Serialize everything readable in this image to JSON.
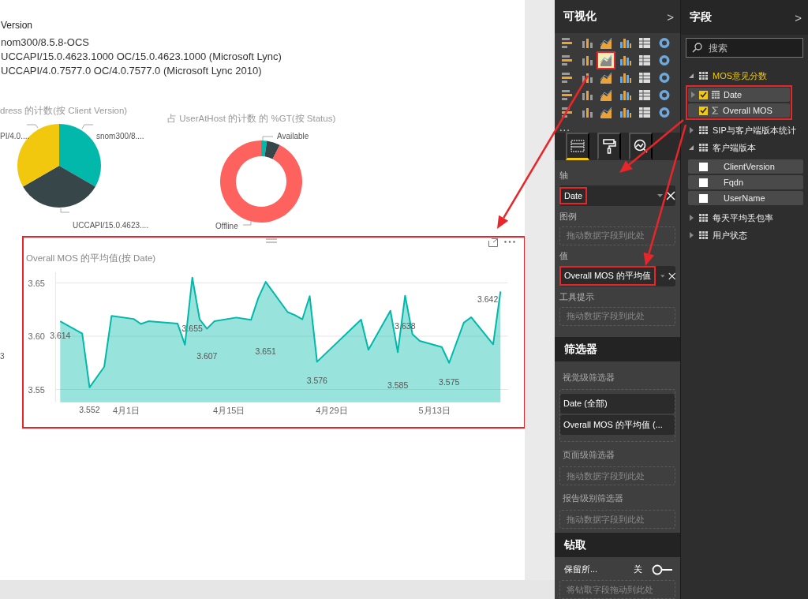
{
  "table_visual": {
    "header": "Version",
    "rows": [
      "nom300/8.5.8-OCS",
      "UCCAPI/15.0.4623.1000 OC/15.0.4623.1000 (Microsoft Lync)",
      "UCCAPI/4.0.7577.0 OC/4.0.7577.0 (Microsoft Lync 2010)"
    ]
  },
  "pie_visual": {
    "title": "dress 的计数(按 Client Version)",
    "labels": [
      "PI/4.0....",
      "snom300/8....",
      "UCCAPI/15.0.4623...."
    ]
  },
  "donut_visual": {
    "title": "占 UserAtHost 的计数 的 %GT(按 Status)",
    "labels": [
      "Available",
      "Offline"
    ]
  },
  "partial_visual_label": "3",
  "line_visual": {
    "highlighted": true,
    "chart_data": {
      "type": "area",
      "title": "Overall MOS 的平均值(按 Date)",
      "categories": [
        null,
        null,
        null,
        null,
        null,
        null,
        null,
        null,
        null,
        "4月1日",
        null,
        null,
        null,
        null,
        null,
        null,
        null,
        null,
        null,
        null,
        null,
        null,
        null,
        "4月15日",
        null,
        null,
        null,
        null,
        null,
        null,
        null,
        null,
        null,
        null,
        null,
        null,
        null,
        "4月29日",
        null,
        null,
        null,
        null,
        null,
        null,
        null,
        null,
        null,
        null,
        null,
        null,
        null,
        "5月13日",
        null,
        null,
        null,
        null,
        null,
        null,
        null,
        null,
        null
      ],
      "series": [
        {
          "color": "#01b8aa",
          "values": [
            3.614,
            null,
            null,
            3.6025,
            3.552,
            null,
            3.5713,
            3.6191,
            null,
            null,
            3.6162,
            3.6115,
            3.614,
            null,
            null,
            null,
            3.6118,
            3.592,
            3.655,
            3.6159,
            3.607,
            3.614,
            null,
            null,
            3.6175,
            null,
            3.6153,
            3.636,
            3.651,
            null,
            null,
            3.6226,
            3.6197,
            3.6159,
            3.6376,
            3.576,
            null,
            null,
            null,
            null,
            null,
            3.6156,
            3.5873,
            null,
            null,
            3.6239,
            3.585,
            3.638,
            3.6019,
            3.5955,
            null,
            null,
            3.5898,
            3.575,
            null,
            3.6127,
            3.6178,
            null,
            null,
            3.5924,
            3.642
          ]
        }
      ],
      "grid": true,
      "ylim": [
        3.538,
        3.66
      ],
      "yticks": [
        3.55,
        {
          "value": 3.6,
          "label": "3.60"
        },
        3.65
      ],
      "annotations": [
        "3.614",
        "3.552",
        "3.655",
        "3.607",
        "3.651",
        "3.576",
        "3.638",
        "3.585",
        "3.575",
        "3.642"
      ]
    }
  },
  "visualizations_pane": {
    "title": "可视化",
    "collapse": ">",
    "gallery": [
      {
        "selected": false
      },
      {
        "selected": false
      },
      {
        "selected": false
      },
      {
        "selected": false
      },
      {
        "selected": false
      },
      {
        "selected": false
      },
      {
        "selected": false
      },
      {
        "selected": false
      },
      {
        "selected": true
      },
      {
        "selected": false
      },
      {
        "selected": false
      },
      {
        "selected": false
      },
      {
        "selected": false
      },
      {
        "selected": false
      },
      {
        "selected": false
      },
      {
        "selected": false
      },
      {
        "selected": false
      },
      {
        "selected": false
      },
      {
        "selected": false
      },
      {
        "selected": false
      },
      {
        "selected": false
      },
      {
        "selected": false
      },
      {
        "selected": false
      },
      {
        "selected": false
      },
      {
        "selected": false
      },
      {
        "selected": false
      },
      {
        "selected": false
      },
      {
        "selected": false
      },
      {
        "selected": false
      },
      {
        "selected": false
      }
    ],
    "more": "...",
    "tabs": [
      {
        "selected": true
      },
      {
        "selected": false
      },
      {
        "selected": false
      }
    ],
    "wells": [
      {
        "label": "轴",
        "kind": "field",
        "value": "Date",
        "highlighted": true
      },
      {
        "label": "图例",
        "kind": "empty",
        "placeholder": "拖动数据字段到此处"
      },
      {
        "label": "值",
        "kind": "field",
        "value": "Overall MOS 的平均值",
        "highlighted": true
      },
      {
        "label": "工具提示",
        "kind": "empty",
        "placeholder": "拖动数据字段到此处"
      }
    ]
  },
  "filters": {
    "title": "筛选器",
    "sections": [
      {
        "label": "视觉级筛选器",
        "cards": [
          "Date (全部)",
          "Overall MOS 的平均值 (..."
        ]
      },
      {
        "label": "页面级筛选器",
        "placeholder": "拖动数据字段到此处"
      },
      {
        "label": "报告级别筛选器",
        "placeholder": "拖动数据字段到此处"
      }
    ]
  },
  "drillthrough": {
    "title": "钻取",
    "keep_label": "保留所...",
    "toggle_text": "关",
    "on": false,
    "placeholder": "将钻取字段拖动到此处"
  },
  "fields_pane": {
    "title": "字段",
    "collapse": ">",
    "search": {
      "placeholder": "搜索"
    },
    "tables": [
      {
        "name": "MOS意见分数",
        "expanded": true,
        "in_use": true,
        "fields_highlighted": true,
        "fields": [
          {
            "name": "Date",
            "kind": "date",
            "checked": true,
            "expandable": true
          },
          {
            "name": "Overall MOS",
            "kind": "measure",
            "checked": true,
            "expandable": false
          }
        ]
      },
      {
        "name": "SIP与客户端版本统计",
        "expanded": false,
        "in_use": false
      },
      {
        "name": "客户端版本",
        "expanded": true,
        "in_use": false,
        "fields_highlighted": false,
        "fields": [
          {
            "name": "ClientVersion",
            "kind": "plain",
            "checked": false,
            "expandable": false
          },
          {
            "name": "Fqdn",
            "kind": "plain",
            "checked": false,
            "expandable": false
          },
          {
            "name": "UserName",
            "kind": "plain",
            "checked": false,
            "expandable": false
          }
        ]
      },
      {
        "name": "每天平均丢包率",
        "expanded": false,
        "in_use": false
      },
      {
        "name": "用户状态",
        "expanded": false,
        "in_use": false
      }
    ]
  }
}
